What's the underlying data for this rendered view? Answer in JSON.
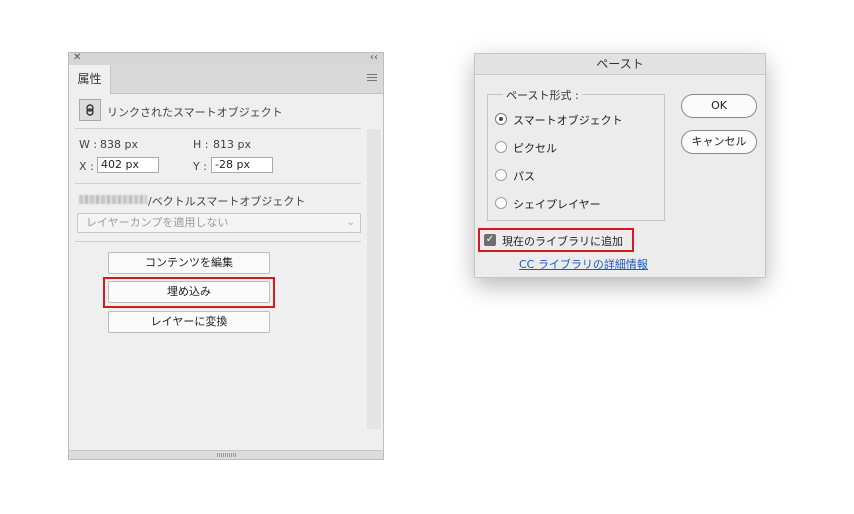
{
  "properties_panel": {
    "close_glyph": "✕",
    "collapse_glyph": "‹‹",
    "tab_label": "属性",
    "layer_type": "リンクされたスマートオブジェクト",
    "w_label": "W :",
    "w_value": "838 px",
    "h_label": "H :",
    "h_value": "813 px",
    "x_label": "X :",
    "x_value": "402 px",
    "y_label": "Y :",
    "y_value": "-28 px",
    "vector_label": "/ベクトルスマートオブジェクト",
    "layer_comp_placeholder": "レイヤーカンプを適用しない",
    "buttons": {
      "edit_contents": "コンテンツを編集",
      "embed": "埋め込み",
      "convert_to_layers": "レイヤーに変換"
    }
  },
  "paste_dialog": {
    "title": "ペースト",
    "format_legend": "ペースト形式 :",
    "options": [
      {
        "label": "スマートオブジェクト",
        "selected": true
      },
      {
        "label": "ピクセル",
        "selected": false
      },
      {
        "label": "パス",
        "selected": false
      },
      {
        "label": "シェイプレイヤー",
        "selected": false
      }
    ],
    "ok_label": "OK",
    "cancel_label": "キャンセル",
    "add_to_library_label": "現在のライブラリに追加",
    "add_to_library_checked": true,
    "cc_link": "CC ライブラリの詳細情報"
  },
  "colors": {
    "highlight": "#d8191c",
    "link": "#1a57c7"
  }
}
